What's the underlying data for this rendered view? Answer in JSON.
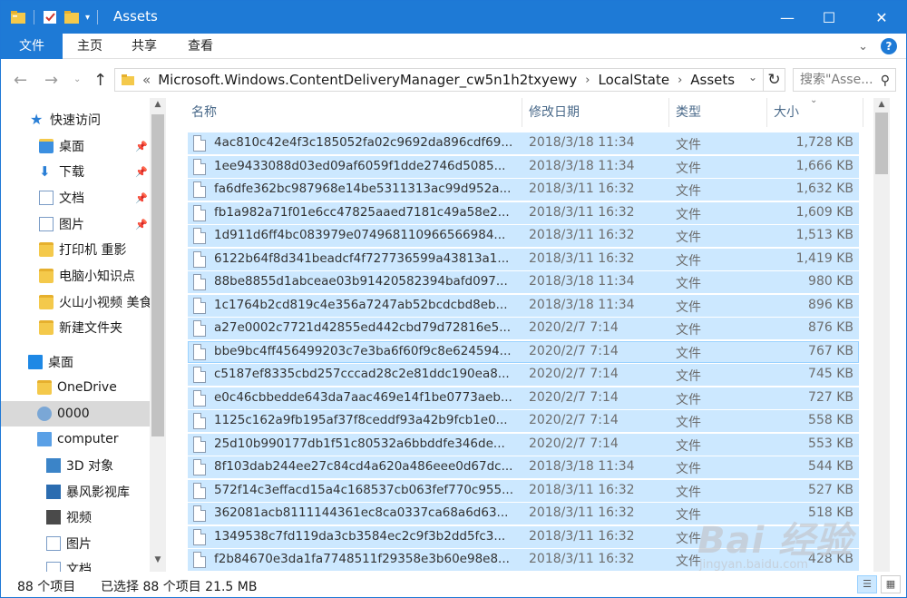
{
  "window": {
    "title": "Assets",
    "controls": {
      "minimize": "—",
      "maximize": "☐",
      "close": "✕"
    }
  },
  "ribbon": {
    "tabs": [
      "文件",
      "主页",
      "共享",
      "查看"
    ],
    "help": "?"
  },
  "address": {
    "breadcrumbs": [
      "Microsoft.Windows.ContentDeliveryManager_cw5n1h2txyewy",
      "LocalState",
      "Assets"
    ],
    "prefix": "«",
    "search_placeholder": "搜索\"Asse..."
  },
  "navigation": {
    "quick_access_label": "快速访问",
    "items": [
      {
        "label": "桌面",
        "icon": "desktop-folder-icon",
        "pinned": true
      },
      {
        "label": "下载",
        "icon": "download-folder-icon",
        "pinned": true
      },
      {
        "label": "文档",
        "icon": "documents-folder-icon",
        "pinned": true
      },
      {
        "label": "图片",
        "icon": "pictures-folder-icon",
        "pinned": true
      },
      {
        "label": "打印机 重影",
        "icon": "folder-icon",
        "pinned": false
      },
      {
        "label": "电脑小知识点",
        "icon": "folder-icon",
        "pinned": false
      },
      {
        "label": "火山小视频 美食",
        "icon": "folder-icon",
        "pinned": false
      },
      {
        "label": "新建文件夹",
        "icon": "folder-icon",
        "pinned": false
      }
    ],
    "tree": [
      {
        "label": "桌面",
        "icon": "desktop-icon"
      },
      {
        "label": "OneDrive",
        "icon": "onedrive-icon"
      },
      {
        "label": "0000",
        "icon": "user-icon",
        "selected": true
      },
      {
        "label": "computer",
        "icon": "computer-icon"
      },
      {
        "label": "3D 对象",
        "icon": "3d-objects-icon"
      },
      {
        "label": "暴风影视库",
        "icon": "media-library-icon"
      },
      {
        "label": "视频",
        "icon": "videos-icon"
      },
      {
        "label": "图片",
        "icon": "pictures-icon"
      },
      {
        "label": "文档",
        "icon": "documents-icon"
      }
    ]
  },
  "columns": {
    "name": "名称",
    "date": "修改日期",
    "type": "类型",
    "size": "大小"
  },
  "files": [
    {
      "name": "4ac810c42e4f3c185052fa02c9692da896cdf69...",
      "date": "2018/3/18 11:34",
      "type": "文件",
      "size": "1,728 KB"
    },
    {
      "name": "1ee9433088d03ed09af6059f1dde2746d5085...",
      "date": "2018/3/18 11:34",
      "type": "文件",
      "size": "1,666 KB"
    },
    {
      "name": "fa6dfe362bc987968e14be5311313ac99d952a...",
      "date": "2018/3/11 16:32",
      "type": "文件",
      "size": "1,632 KB"
    },
    {
      "name": "fb1a982a71f01e6cc47825aaed7181c49a58e2...",
      "date": "2018/3/11 16:32",
      "type": "文件",
      "size": "1,609 KB"
    },
    {
      "name": "1d911d6ff4bc083979e074968110966566984...",
      "date": "2018/3/11 16:32",
      "type": "文件",
      "size": "1,513 KB"
    },
    {
      "name": "6122b64f8d341beadcf4f727736599a43813a1...",
      "date": "2018/3/11 16:32",
      "type": "文件",
      "size": "1,419 KB"
    },
    {
      "name": "88be8855d1abceae03b91420582394bafd097...",
      "date": "2018/3/18 11:34",
      "type": "文件",
      "size": "980 KB"
    },
    {
      "name": "1c1764b2cd819c4e356a7247ab52bcdcbd8eb...",
      "date": "2018/3/18 11:34",
      "type": "文件",
      "size": "896 KB"
    },
    {
      "name": "a27e0002c7721d42855ed442cbd79d72816e5...",
      "date": "2020/2/7 7:14",
      "type": "文件",
      "size": "876 KB"
    },
    {
      "name": "bbe9bc4ff456499203c7e3ba6f60f9c8e624594...",
      "date": "2020/2/7 7:14",
      "type": "文件",
      "size": "767 KB"
    },
    {
      "name": "c5187ef8335cbd257cccad28c2e81ddc190ea8...",
      "date": "2020/2/7 7:14",
      "type": "文件",
      "size": "745 KB"
    },
    {
      "name": "e0c46cbbedde643da7aac469e14f1be0773aeb...",
      "date": "2020/2/7 7:14",
      "type": "文件",
      "size": "727 KB"
    },
    {
      "name": "1125c162a9fb195af37f8ceddf93a42b9fcb1e0...",
      "date": "2020/2/7 7:14",
      "type": "文件",
      "size": "558 KB"
    },
    {
      "name": "25d10b990177db1f51c80532a6bbddfe346de...",
      "date": "2020/2/7 7:14",
      "type": "文件",
      "size": "553 KB"
    },
    {
      "name": "8f103dab244ee27c84cd4a620a486eee0d67dc...",
      "date": "2018/3/18 11:34",
      "type": "文件",
      "size": "544 KB"
    },
    {
      "name": "572f14c3effacd15a4c168537cb063fef770c955...",
      "date": "2018/3/11 16:32",
      "type": "文件",
      "size": "527 KB"
    },
    {
      "name": "362081acb8111144361ec8ca0337ca68a6d63...",
      "date": "2018/3/11 16:32",
      "type": "文件",
      "size": "518 KB"
    },
    {
      "name": "1349538c7fd119da3cb3584ec2c9f3b2dd5fc3...",
      "date": "2018/3/11 16:32",
      "type": "文件",
      "size": ""
    },
    {
      "name": "f2b84670e3da1fa7748511f29358e3b60e98e8...",
      "date": "2018/3/11 16:32",
      "type": "文件",
      "size": "428 KB"
    }
  ],
  "status": {
    "count": "88 个项目",
    "selection": "已选择 88 个项目  21.5 MB"
  },
  "watermark": {
    "text": "Bai 经验",
    "sub": "jingyan.baidu.com"
  },
  "colors": {
    "accent": "#1e7ad6",
    "selection": "#cce8ff"
  }
}
